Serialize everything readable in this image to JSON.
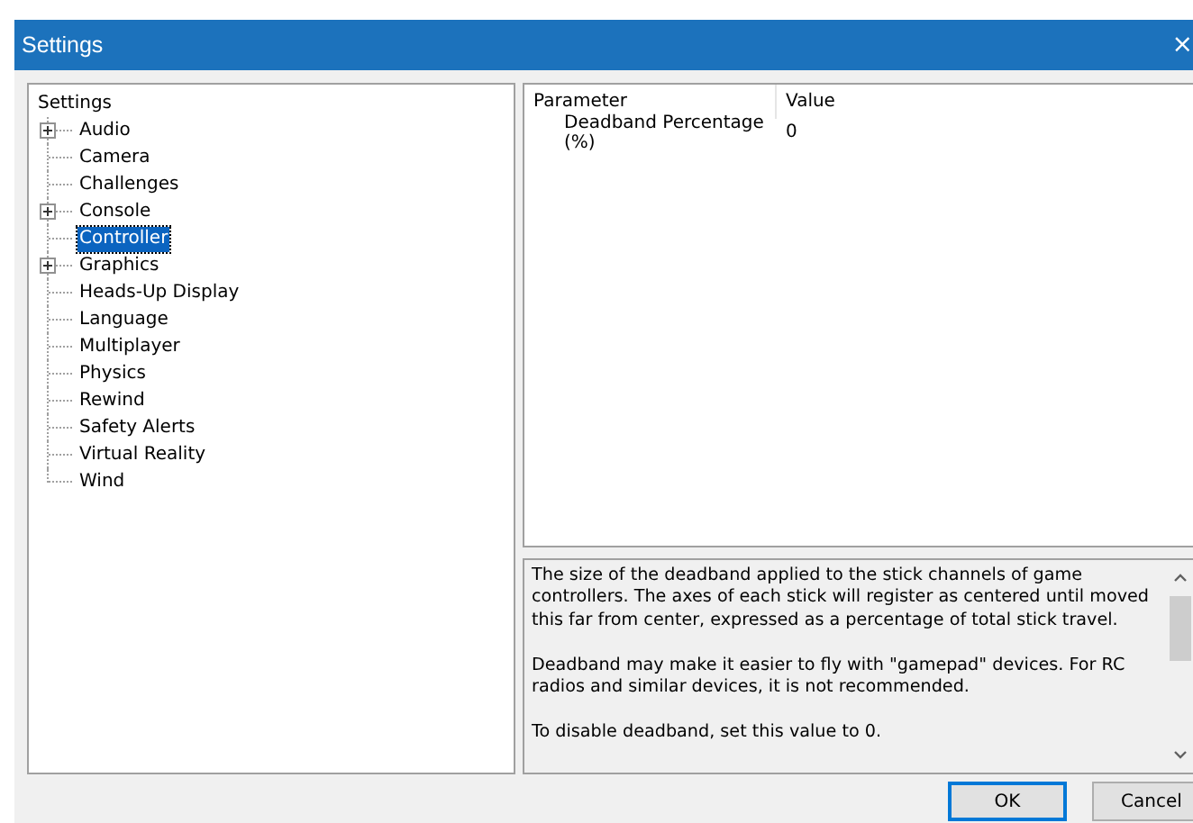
{
  "window": {
    "title": "Settings",
    "close": "×"
  },
  "tree": {
    "label": "Settings",
    "children": [
      {
        "label": "Audio",
        "expanded": false,
        "has_children": true,
        "selected": false
      },
      {
        "label": "Camera",
        "has_children": false,
        "selected": false
      },
      {
        "label": "Challenges",
        "has_children": false,
        "selected": false
      },
      {
        "label": "Console",
        "expanded": false,
        "has_children": true,
        "selected": false
      },
      {
        "label": "Controller",
        "has_children": false,
        "selected": true
      },
      {
        "label": "Graphics",
        "expanded": false,
        "has_children": true,
        "selected": false
      },
      {
        "label": "Heads-Up Display",
        "has_children": false,
        "selected": false
      },
      {
        "label": "Language",
        "has_children": false,
        "selected": false
      },
      {
        "label": "Multiplayer",
        "has_children": false,
        "selected": false
      },
      {
        "label": "Physics",
        "has_children": false,
        "selected": false
      },
      {
        "label": "Rewind",
        "has_children": false,
        "selected": false
      },
      {
        "label": "Safety Alerts",
        "has_children": false,
        "selected": false
      },
      {
        "label": "Virtual Reality",
        "has_children": false,
        "selected": false
      },
      {
        "label": "Wind",
        "has_children": false,
        "selected": false
      }
    ]
  },
  "table": {
    "columns": [
      "Parameter",
      "Value"
    ],
    "rows": [
      {
        "parameter": "Deadband Percentage (%)",
        "value": "0"
      }
    ]
  },
  "description": [
    "The size of the deadband applied to the stick channels of game controllers. The axes of each stick will register as centered until moved this far from center, expressed as a percentage of total stick travel.",
    "Deadband may make it easier to fly with \"gamepad\" devices. For RC radios and similar devices, it is not recommended.",
    "To disable deadband, set this value to 0."
  ],
  "buttons": [
    "OK",
    "Cancel"
  ]
}
